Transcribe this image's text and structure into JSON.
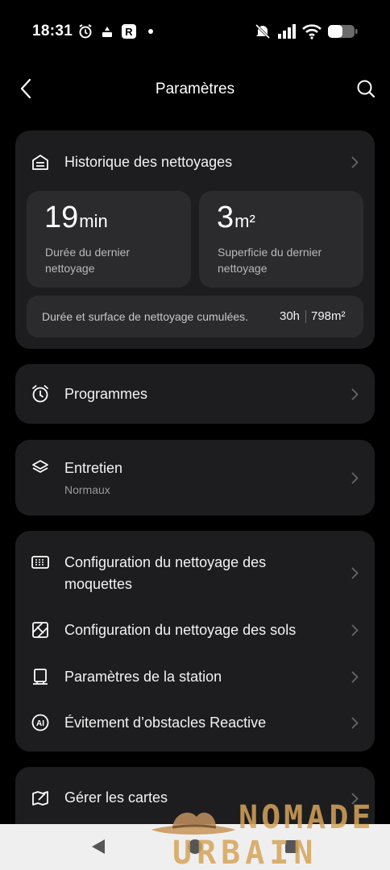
{
  "status_bar": {
    "time": "18:31",
    "icons": [
      "alarm-icon",
      "camera-icon",
      "r-app-icon",
      "dot-icon",
      "mute-icon",
      "signal-icon",
      "wifi-icon",
      "battery-icon"
    ]
  },
  "header": {
    "title": "Paramètres",
    "back_icon": "chevron-left-icon",
    "search_icon": "search-icon"
  },
  "history": {
    "label": "Historique des nettoyages",
    "last_duration": {
      "value": "19",
      "unit": "min",
      "label": "Durée du dernier nettoyage"
    },
    "last_area": {
      "value": "3",
      "unit": "m²",
      "label": "Superficie du dernier nettoyage"
    },
    "cumulative": {
      "label": "Durée et surface de nettoyage cumulées.",
      "hours": "30h",
      "area": "798m²"
    }
  },
  "programmes": {
    "label": "Programmes"
  },
  "entretien": {
    "label": "Entretien",
    "sub": "Normaux"
  },
  "config_group": {
    "items": [
      {
        "label_line1": "Configuration du nettoyage des",
        "label_line2": "moquettes",
        "icon": "carpet-icon"
      },
      {
        "label": "Configuration du nettoyage des sols",
        "icon": "floor-icon"
      },
      {
        "label": "Paramètres de la station",
        "icon": "station-icon"
      },
      {
        "label": "Évitement d’obstacles Reactive",
        "icon": "ai-icon"
      }
    ]
  },
  "maps": {
    "label": "Gérer les cartes"
  },
  "watermark": {
    "line1": "NOMADE",
    "line2": "URBAIN"
  },
  "colors": {
    "background": "#000000",
    "card": "#1d1d1f",
    "inner_box": "#2b2b2e",
    "watermark": "#d6a45a"
  }
}
